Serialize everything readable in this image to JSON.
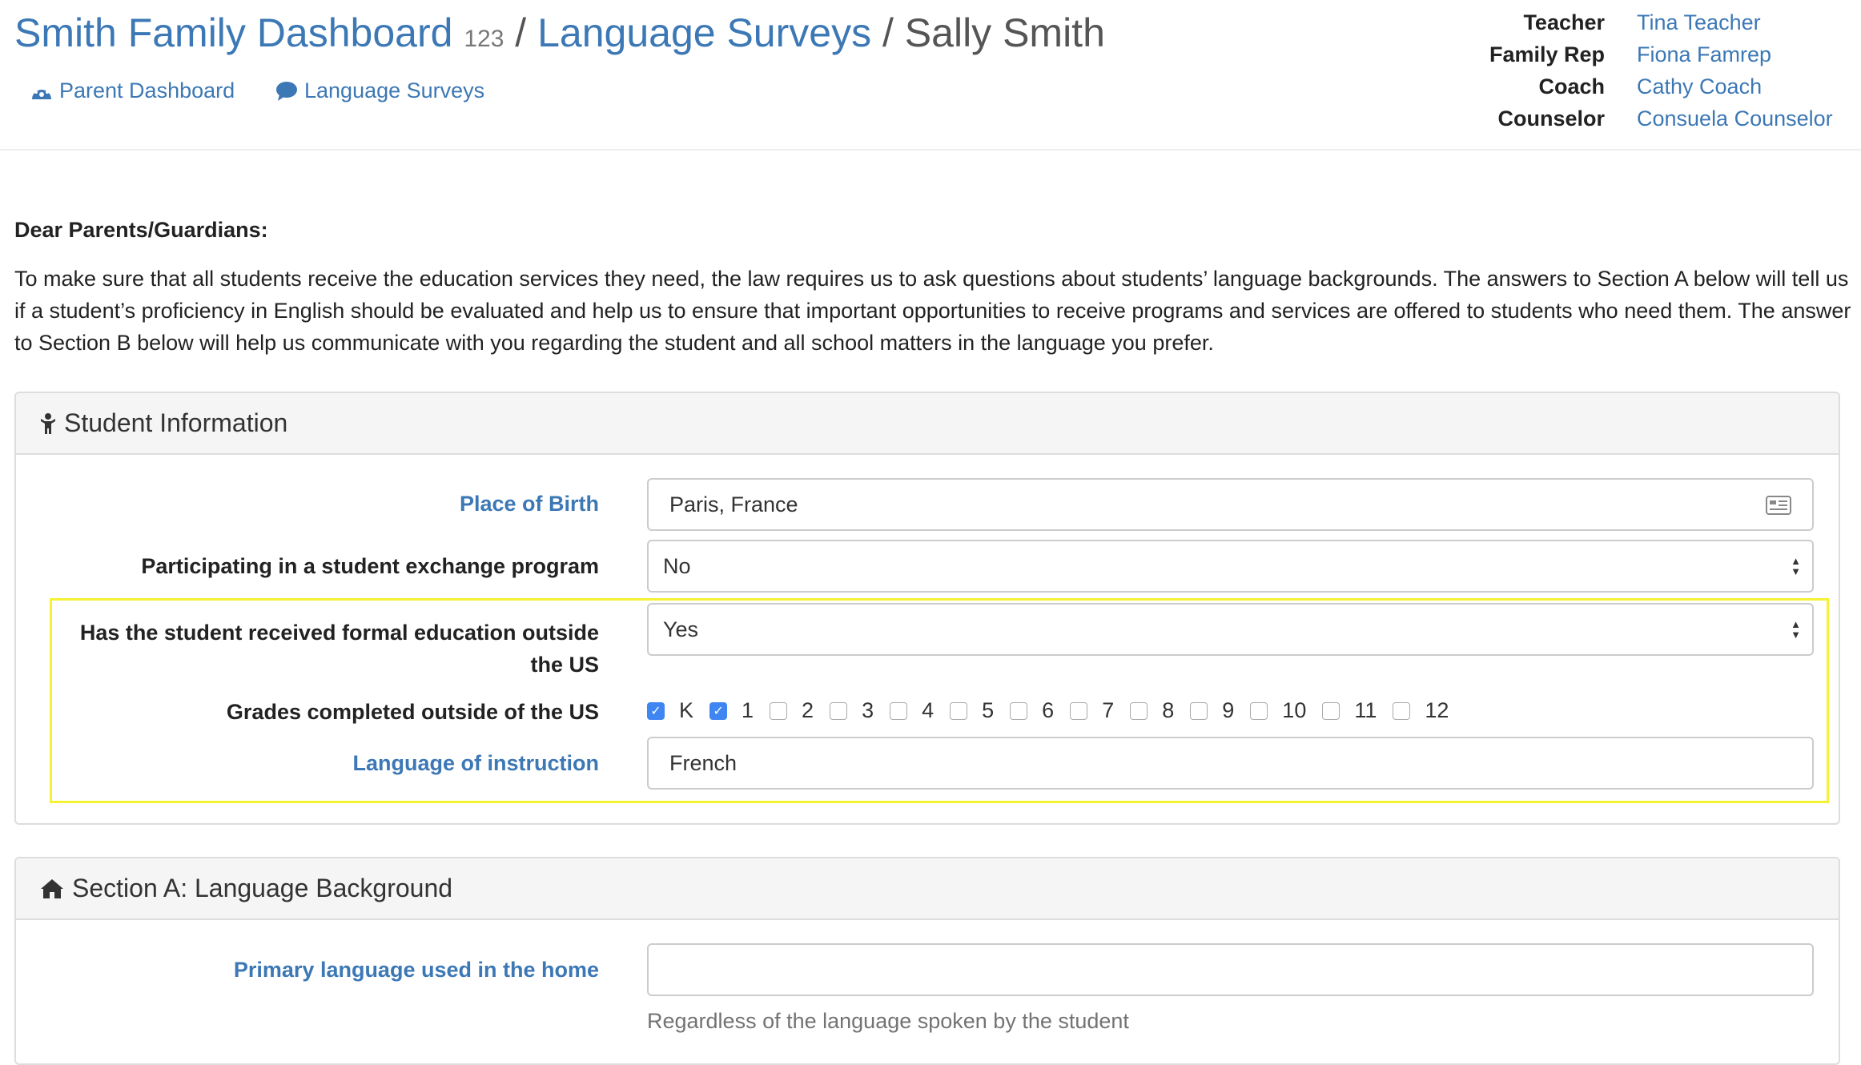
{
  "header": {
    "breadcrumb": [
      {
        "label": "Smith Family Dashboard"
      },
      {
        "label": "123"
      },
      {
        "label": "Language Surveys"
      },
      {
        "label": "Sally Smith"
      }
    ],
    "separator": "/",
    "nav": [
      {
        "label": "Parent Dashboard",
        "icon": "dashboard-icon"
      },
      {
        "label": "Language Surveys",
        "icon": "comment-icon"
      }
    ],
    "staff": [
      {
        "role": "Teacher",
        "name": "Tina Teacher"
      },
      {
        "role": "Family Rep",
        "name": "Fiona Famrep"
      },
      {
        "role": "Coach",
        "name": "Cathy Coach"
      },
      {
        "role": "Counselor",
        "name": "Consuela Counselor"
      }
    ]
  },
  "intro": {
    "greeting": "Dear Parents/Guardians:",
    "body": "To make sure that all students receive the education services they need, the law requires us to ask questions about students’ language backgrounds. The answers to Section A below will tell us if a student’s proficiency in English should be evaluated and help us to ensure that important opportunities to receive programs and services are offered to students who need them. The answer to Section B below will help us communicate with you regarding the student and all school matters in the language you prefer."
  },
  "student_info": {
    "title": "Student Information",
    "place_of_birth": {
      "label": "Place of Birth",
      "value": "Paris, France"
    },
    "exchange": {
      "label": "Participating in a student exchange program",
      "value": "No"
    },
    "formal_edu": {
      "label_line1": "Has the student received formal education outside",
      "label_line2": "the US",
      "value": "Yes"
    },
    "grades": {
      "label": "Grades completed outside of the US",
      "options": [
        {
          "label": "K",
          "checked": true
        },
        {
          "label": "1",
          "checked": true
        },
        {
          "label": "2",
          "checked": false
        },
        {
          "label": "3",
          "checked": false
        },
        {
          "label": "4",
          "checked": false
        },
        {
          "label": "5",
          "checked": false
        },
        {
          "label": "6",
          "checked": false
        },
        {
          "label": "7",
          "checked": false
        },
        {
          "label": "8",
          "checked": false
        },
        {
          "label": "9",
          "checked": false
        },
        {
          "label": "10",
          "checked": false
        },
        {
          "label": "11",
          "checked": false
        },
        {
          "label": "12",
          "checked": false
        }
      ]
    },
    "instruction_lang": {
      "label": "Language of instruction",
      "value": "French"
    }
  },
  "section_a": {
    "title": "Section A: Language Background",
    "primary_lang": {
      "label": "Primary language used in the home",
      "value": "",
      "help": "Regardless of the language spoken by the student"
    }
  },
  "colors": {
    "link": "#3c78b5",
    "highlight": "#f4f232",
    "checkbox": "#3f86f2"
  }
}
